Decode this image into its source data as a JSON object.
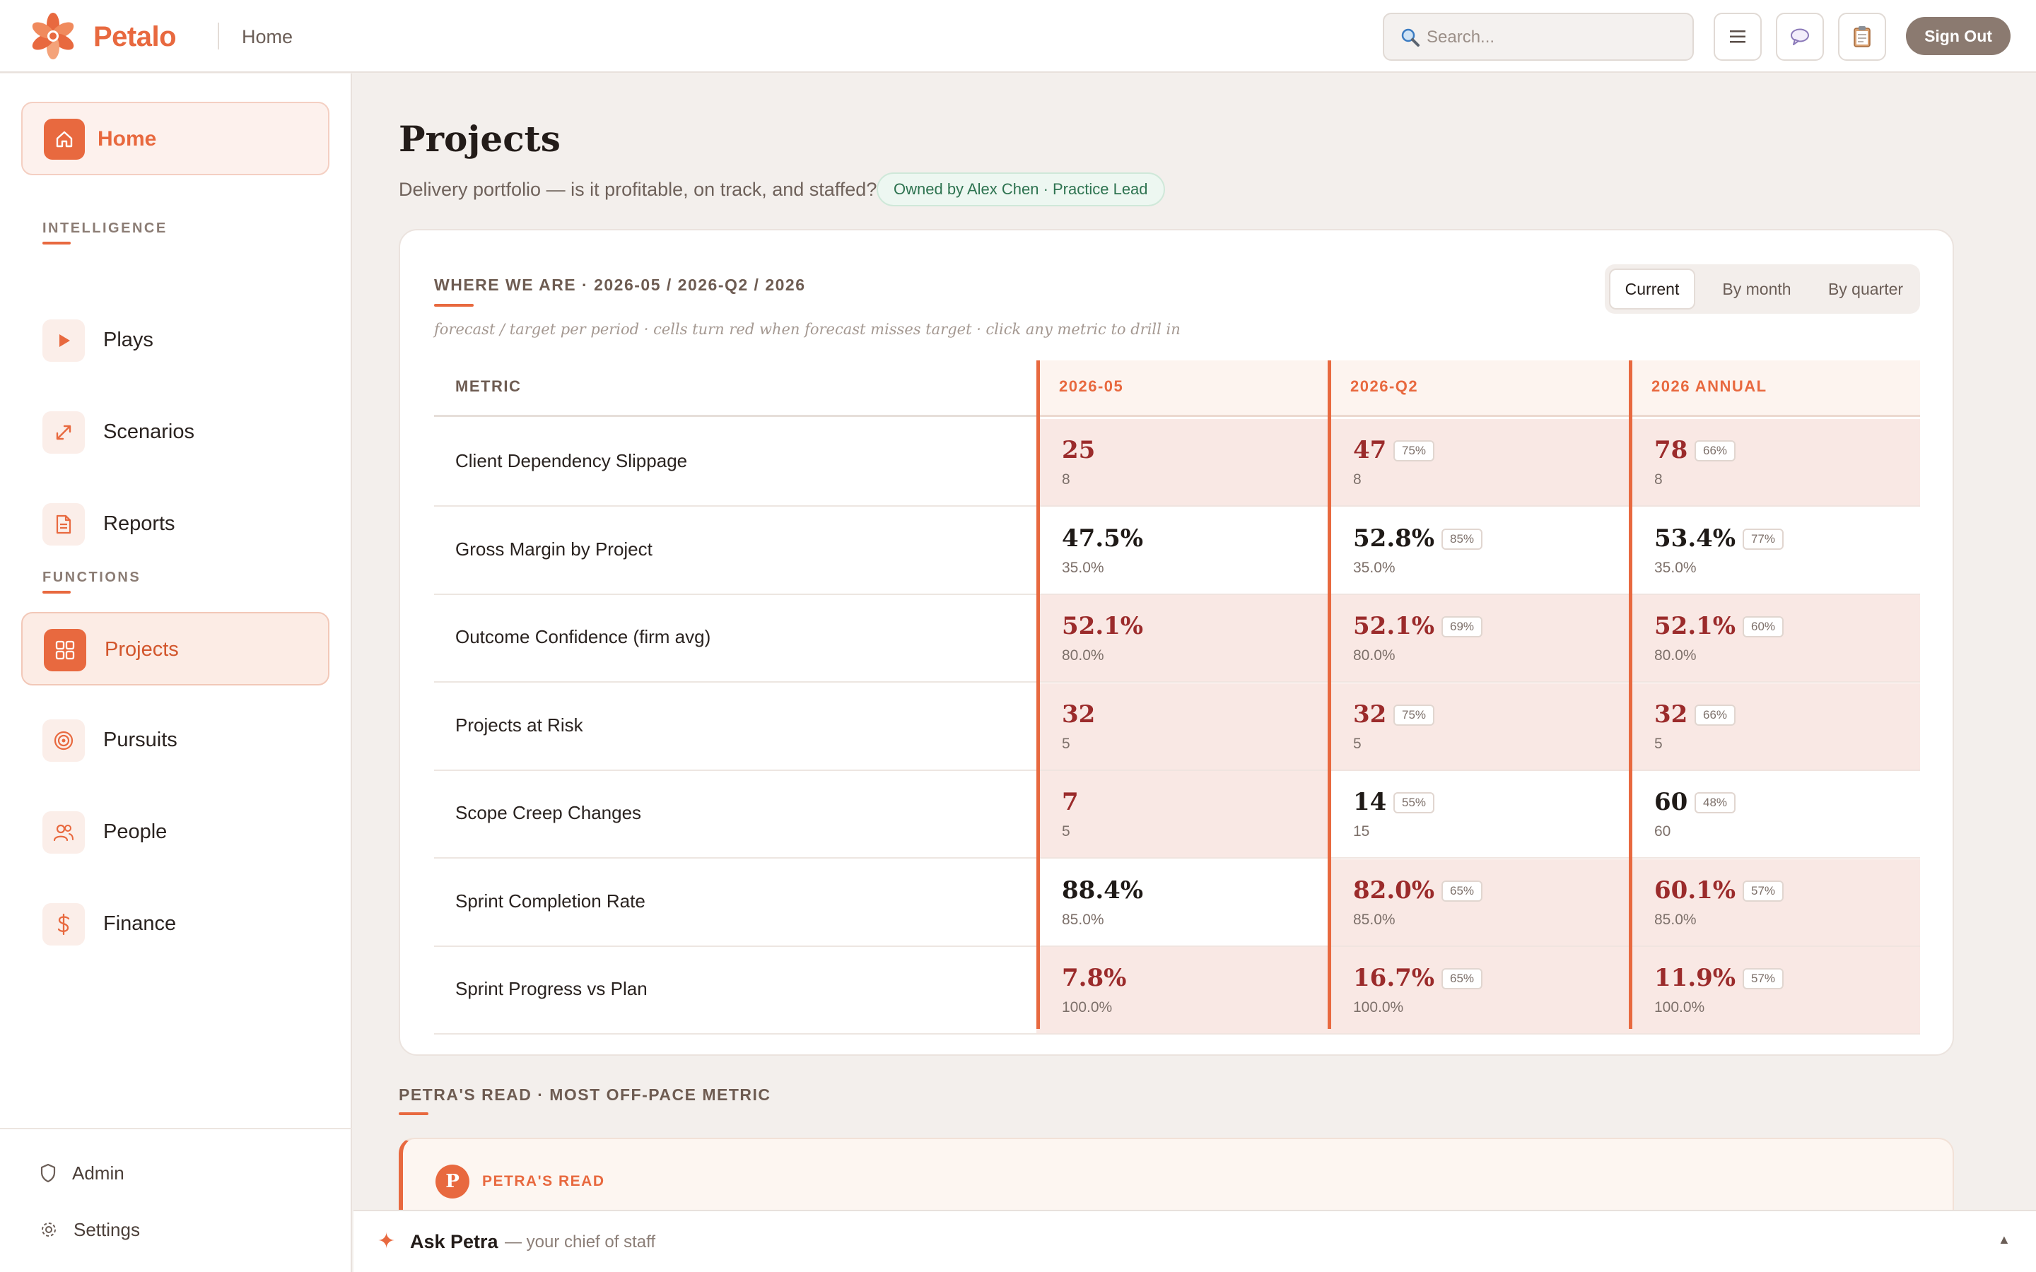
{
  "app": {
    "brand": "Petalo",
    "breadcrumb": "Home",
    "search_placeholder": "Search...",
    "sign_out": "Sign Out",
    "accent": "#e8693f",
    "icons": [
      "menu-icon",
      "chat-icon",
      "clipboard-icon"
    ]
  },
  "sidebar": {
    "home": "Home",
    "sections": [
      {
        "label": "INTELLIGENCE",
        "items": [
          {
            "label": "Plays",
            "icon": "play-icon"
          },
          {
            "label": "Scenarios",
            "icon": "expand-icon"
          },
          {
            "label": "Reports",
            "icon": "document-icon"
          }
        ]
      },
      {
        "label": "FUNCTIONS",
        "items": [
          {
            "label": "Projects",
            "icon": "grid-icon",
            "active": true
          },
          {
            "label": "Pursuits",
            "icon": "target-icon"
          },
          {
            "label": "People",
            "icon": "people-icon"
          },
          {
            "label": "Finance",
            "icon": "dollar-icon"
          }
        ]
      }
    ],
    "footer": [
      {
        "label": "Admin",
        "icon": "shield-icon"
      },
      {
        "label": "Settings",
        "icon": "gear-icon"
      }
    ]
  },
  "page": {
    "title": "Projects",
    "subtitle": "Delivery portfolio — is it profitable, on track, and staffed?",
    "owner": "Owned by Alex Chen · Practice Lead"
  },
  "card": {
    "title": "WHERE WE ARE · 2026-05 / 2026-Q2 / 2026",
    "note": "forecast / target per period · cells turn red when forecast misses target · click any metric to drill in",
    "toggle": [
      "Current",
      "By month",
      "By quarter"
    ],
    "toggle_selected": "Current",
    "columns": [
      "METRIC",
      "2026-05",
      "2026-Q2",
      "2026 ANNUAL"
    ],
    "rows": [
      {
        "metric": "Client Dependency Slippage",
        "cells": [
          {
            "forecast": "25",
            "target": "8",
            "pct": "",
            "miss": true
          },
          {
            "forecast": "47",
            "target": "8",
            "pct": "75%",
            "miss": true
          },
          {
            "forecast": "78",
            "target": "8",
            "pct": "66%",
            "miss": true
          }
        ]
      },
      {
        "metric": "Gross Margin by Project",
        "cells": [
          {
            "forecast": "47.5%",
            "target": "35.0%",
            "pct": "",
            "miss": false
          },
          {
            "forecast": "52.8%",
            "target": "35.0%",
            "pct": "85%",
            "miss": false
          },
          {
            "forecast": "53.4%",
            "target": "35.0%",
            "pct": "77%",
            "miss": false
          }
        ]
      },
      {
        "metric": "Outcome Confidence (firm avg)",
        "cells": [
          {
            "forecast": "52.1%",
            "target": "80.0%",
            "pct": "",
            "miss": true
          },
          {
            "forecast": "52.1%",
            "target": "80.0%",
            "pct": "69%",
            "miss": true
          },
          {
            "forecast": "52.1%",
            "target": "80.0%",
            "pct": "60%",
            "miss": true
          }
        ]
      },
      {
        "metric": "Projects at Risk",
        "cells": [
          {
            "forecast": "32",
            "target": "5",
            "pct": "",
            "miss": true
          },
          {
            "forecast": "32",
            "target": "5",
            "pct": "75%",
            "miss": true
          },
          {
            "forecast": "32",
            "target": "5",
            "pct": "66%",
            "miss": true
          }
        ]
      },
      {
        "metric": "Scope Creep Changes",
        "cells": [
          {
            "forecast": "7",
            "target": "5",
            "pct": "",
            "miss": true
          },
          {
            "forecast": "14",
            "target": "15",
            "pct": "55%",
            "miss": false
          },
          {
            "forecast": "60",
            "target": "60",
            "pct": "48%",
            "miss": false
          }
        ]
      },
      {
        "metric": "Sprint Completion Rate",
        "cells": [
          {
            "forecast": "88.4%",
            "target": "85.0%",
            "pct": "",
            "miss": false
          },
          {
            "forecast": "82.0%",
            "target": "85.0%",
            "pct": "65%",
            "miss": true
          },
          {
            "forecast": "60.1%",
            "target": "85.0%",
            "pct": "57%",
            "miss": true
          }
        ]
      },
      {
        "metric": "Sprint Progress vs Plan",
        "cells": [
          {
            "forecast": "7.8%",
            "target": "100.0%",
            "pct": "",
            "miss": true
          },
          {
            "forecast": "16.7%",
            "target": "100.0%",
            "pct": "65%",
            "miss": true
          },
          {
            "forecast": "11.9%",
            "target": "100.0%",
            "pct": "57%",
            "miss": true
          }
        ]
      }
    ]
  },
  "petra": {
    "section_title": "PETRA'S READ · MOST OFF-PACE METRIC",
    "avatar": "P",
    "label": "PETRA'S READ"
  },
  "ask": {
    "spark": "✦",
    "title": "Ask Petra",
    "subtitle": "— your chief of staff",
    "caret": "▲"
  }
}
